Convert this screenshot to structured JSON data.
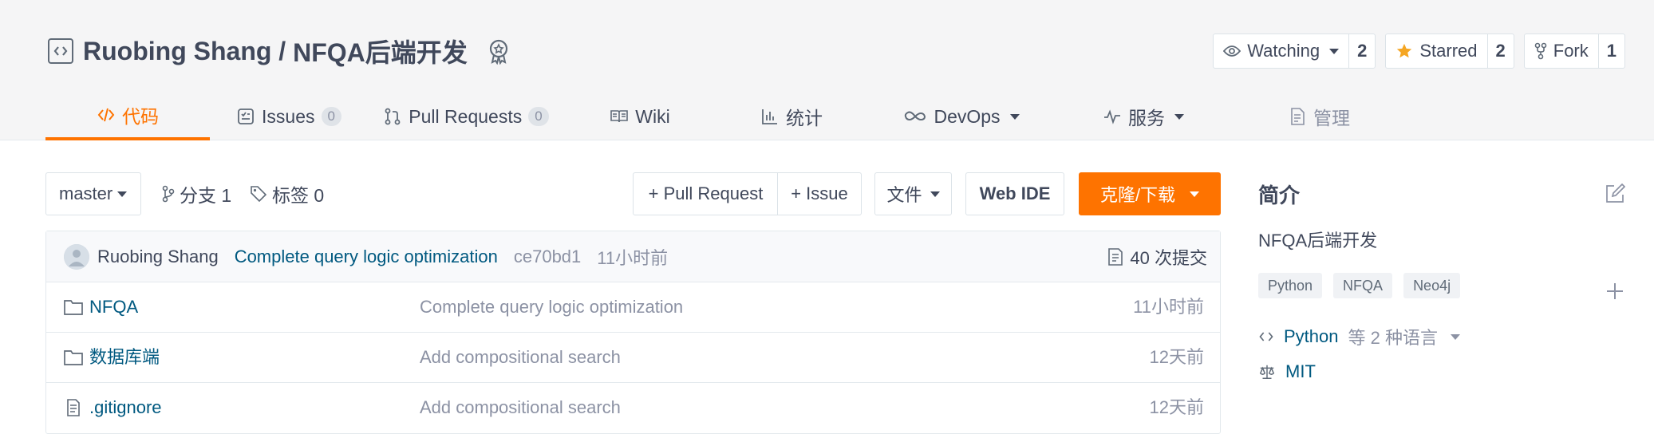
{
  "repo": {
    "owner": "Ruobing Shang",
    "separator": " / ",
    "name": "NFQA后端开发"
  },
  "actions": [
    {
      "label": "Watching",
      "count": "2"
    },
    {
      "label": "Starred",
      "count": "2"
    },
    {
      "label": "Fork",
      "count": "1"
    }
  ],
  "tabs": [
    {
      "label": "代码",
      "icon": "code-icon",
      "active": true
    },
    {
      "label": "Issues",
      "count": "0",
      "icon": "issue-icon"
    },
    {
      "label": "Pull Requests",
      "count": "0",
      "icon": "pull-request-icon"
    },
    {
      "label": "Wiki",
      "icon": "book-icon"
    },
    {
      "label": "统计",
      "icon": "chart-icon"
    },
    {
      "label": "DevOps",
      "icon": "infinity-icon",
      "dropdown": true
    },
    {
      "label": "服务",
      "icon": "pulse-icon",
      "dropdown": true
    },
    {
      "label": "管理",
      "icon": "document-icon"
    }
  ],
  "toolbar": {
    "branch": "master",
    "branches": "分支 1",
    "tags": "标签 0",
    "pull_request": "+ Pull Request",
    "issue": "+ Issue",
    "files": "文件",
    "web_ide": "Web IDE",
    "clone": "克隆/下载"
  },
  "commit": {
    "author": "Ruobing Shang",
    "message": "Complete query logic optimization",
    "hash": "ce70bd1",
    "time": "11小时前",
    "count": "40 次提交"
  },
  "files": [
    {
      "type": "folder",
      "name": "NFQA",
      "message": "Complete query logic optimization",
      "time": "11小时前"
    },
    {
      "type": "folder",
      "name": "数据库端",
      "message": "Add compositional search",
      "time": "12天前"
    },
    {
      "type": "file",
      "name": ".gitignore",
      "message": "Add compositional search",
      "time": "12天前"
    }
  ],
  "side": {
    "title": "简介",
    "description": "NFQA后端开发",
    "tags": [
      "Python",
      "NFQA",
      "Neo4j"
    ],
    "language": "Python",
    "language_more": "等 2 种语言",
    "license": "MIT"
  },
  "colors": {
    "accent": "#fe7300",
    "link": "#005980",
    "muted": "#8c92a4",
    "text": "#40485b"
  }
}
